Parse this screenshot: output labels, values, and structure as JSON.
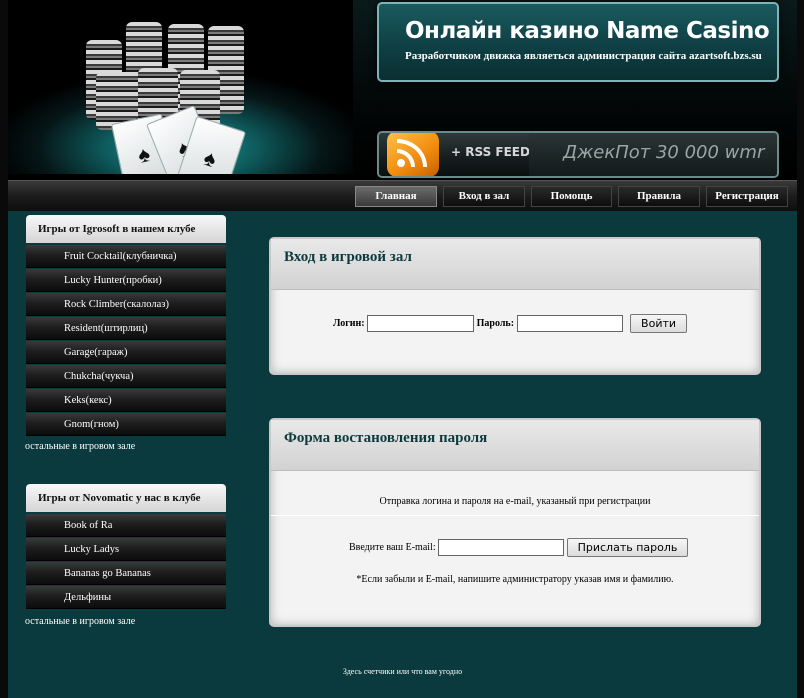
{
  "header": {
    "title": "Онлайн казино Name Casino",
    "subtitle": "Разработчиком движка являеться администрация сайта azartsoft.bzs.su",
    "rss_label": "+ RSS FEED",
    "jackpot": "ДжекПот 30 000 wmr",
    "hero_card_symbol": "♠"
  },
  "nav": {
    "items": [
      {
        "label": "Главная"
      },
      {
        "label": "Вход в зал"
      },
      {
        "label": "Помощь"
      },
      {
        "label": "Правила"
      },
      {
        "label": "Регистрация"
      }
    ]
  },
  "sidebar": {
    "igrosoft": {
      "title": "Игры от Igrosoft в нашем клубе",
      "items": [
        "Fruit Cocktail(клубничка)",
        "Lucky Hunter(пробки)",
        "Rock Climber(скалолаз)",
        "Resident(штирлиц)",
        "Garage(гараж)",
        "Chukcha(чукча)",
        "Keks(кекс)",
        "Gnom(гном)"
      ],
      "more": "остальные в игровом зале"
    },
    "novomatic": {
      "title": "Игры от Novomatic у нас в клубе",
      "items": [
        "Book of Ra",
        "Lucky Ladys",
        "Bananas go Bananas",
        "Дельфины"
      ],
      "more": "остальные в игровом зале"
    }
  },
  "login": {
    "title": "Вход в игровой зал",
    "login_label": "Логин:",
    "login_value": "",
    "password_label": "Пароль:",
    "password_value": "",
    "submit": "Войти"
  },
  "recovery": {
    "title": "Форма востановления пароля",
    "info": "Отправка логина и пароля на e-mail, указаный при регистрации",
    "email_label": "Введите ваш E-mail:",
    "email_value": "",
    "submit": "Прислать пароль",
    "note": "*Если забыли и E-mail, напишите администратору указав имя и фамилию."
  },
  "footer": {
    "counters": "Здесь счетчики или что вам угодно"
  },
  "colors": {
    "main_bg": "#0a3a3d",
    "title_box": "#0e3e42",
    "panel_heading": "#0d3a3d"
  }
}
